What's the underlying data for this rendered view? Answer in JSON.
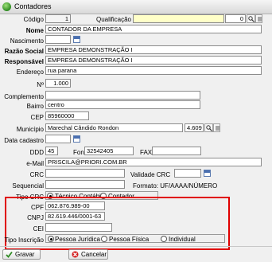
{
  "window": {
    "title": "Contadores"
  },
  "labels": {
    "codigo": "Código",
    "qualificacao": "Qualificação",
    "nome": "Nome",
    "nascimento": "Nascimento",
    "razao_social": "Razão Social",
    "responsavel": "Responsável",
    "endereco": "Endereço",
    "numero": "Nº",
    "complemento": "Complemento",
    "bairro": "Bairro",
    "cep": "CEP",
    "municipio": "Município",
    "data_cadastro": "Data cadastro",
    "ddd": "DDD",
    "fone": "Fone",
    "fax": "FAX",
    "email": "e-Mail",
    "crc": "CRC",
    "validade_crc": "Validade CRC",
    "sequencial": "Sequencial",
    "formato": "Formato: UF/AAAA/NÚMERO",
    "tipo_crc": "Tipo CRC",
    "cpf": "CPF",
    "cnpj": "CNPJ",
    "cei": "CEI",
    "tipo_inscricao": "Tipo Inscrição"
  },
  "values": {
    "codigo": "1",
    "qualificacao_code": "0",
    "qualificacao_name": "",
    "nome": "CONTADOR DA EMPRESA",
    "nascimento": "",
    "razao_social": "EMPRESA DEMONSTRAÇÃO I",
    "responsavel": "EMPRESA DEMONSTRAÇÃO I",
    "endereco": "rua parana",
    "numero": "1.000",
    "complemento": "",
    "bairro": "centro",
    "cep": "85960000",
    "municipio": "Marechal Cândido Rondon",
    "municipio_code": "4.609",
    "data_cadastro": "",
    "ddd": "45",
    "fone": "32542405",
    "fax": "",
    "email": "PRISCILA@PRIORI.COM.BR",
    "crc": "",
    "validade_crc": "",
    "sequencial": "",
    "cpf": "062.876.989-00",
    "cnpj": "82.619.446/0001-63",
    "cei": ""
  },
  "tipo_crc_options": [
    {
      "label": "Técnico Contábil",
      "selected": true
    },
    {
      "label": "Contador",
      "selected": false
    }
  ],
  "tipo_inscricao_options": [
    {
      "label": "Pessoa Jurídica",
      "selected": true
    },
    {
      "label": "Pessoa Física",
      "selected": false
    },
    {
      "label": "Individual",
      "selected": false
    }
  ],
  "buttons": {
    "gravar": "Gravar",
    "cancelar": "Cancelar"
  },
  "colors": {
    "highlight": "#e00000",
    "required_field": "#ffffc8"
  },
  "icons": {
    "app": "green-dot-icon",
    "calendar": "calendar-icon",
    "search": "search-icon",
    "save": "check-icon",
    "cancel": "cancel-icon"
  }
}
